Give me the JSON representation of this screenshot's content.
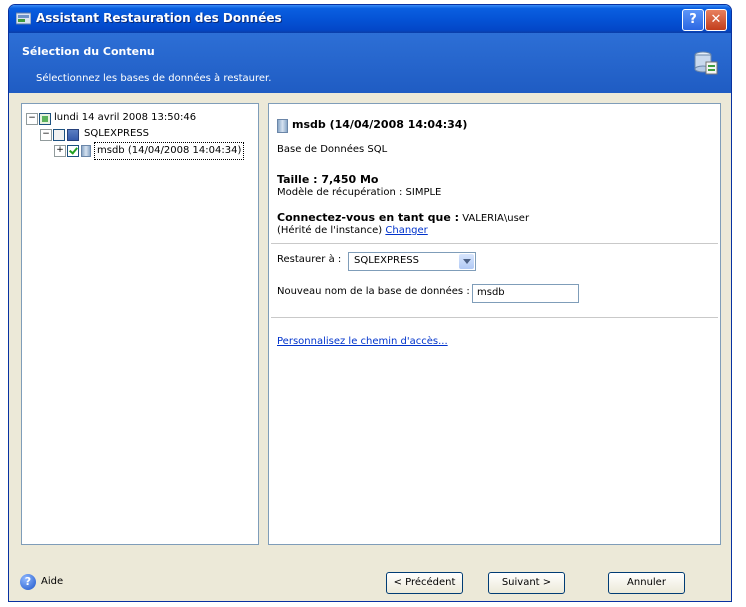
{
  "window": {
    "title": "Assistant Restauration des Données"
  },
  "header": {
    "title": "Sélection du Contenu",
    "subtitle": "Sélectionnez les bases de données à restaurer."
  },
  "tree": {
    "root": "lundi 14 avril 2008 13:50:46",
    "instance": "SQLEXPRESS",
    "database": "msdb (14/04/2008 14:04:34)"
  },
  "detail": {
    "heading": "msdb (14/04/2008 14:04:34)",
    "type": "Base de Données SQL",
    "size": "Taille : 7,450 Mo",
    "recovery": "Modèle de récupération : SIMPLE",
    "connect_label": "Connectez-vous en tant que :",
    "connect_user": "VALERIA\\user",
    "inherited": "(Hérité de l'instance)",
    "change_link": "Changer",
    "restore_to_label": "Restaurer à :",
    "restore_to_value": "SQLEXPRESS",
    "new_name_label": "Nouveau nom de la base de données :",
    "new_name_value": "msdb",
    "custom_path_link": "Personnalisez le chemin d'accès..."
  },
  "footer": {
    "help": "Aide",
    "previous": "< Précédent",
    "next": "Suivant >",
    "cancel": "Annuler"
  },
  "colors": {
    "titlebar": "#0553d6",
    "header": "#2563cb",
    "face": "#ece9d8",
    "link": "#0033cc"
  }
}
